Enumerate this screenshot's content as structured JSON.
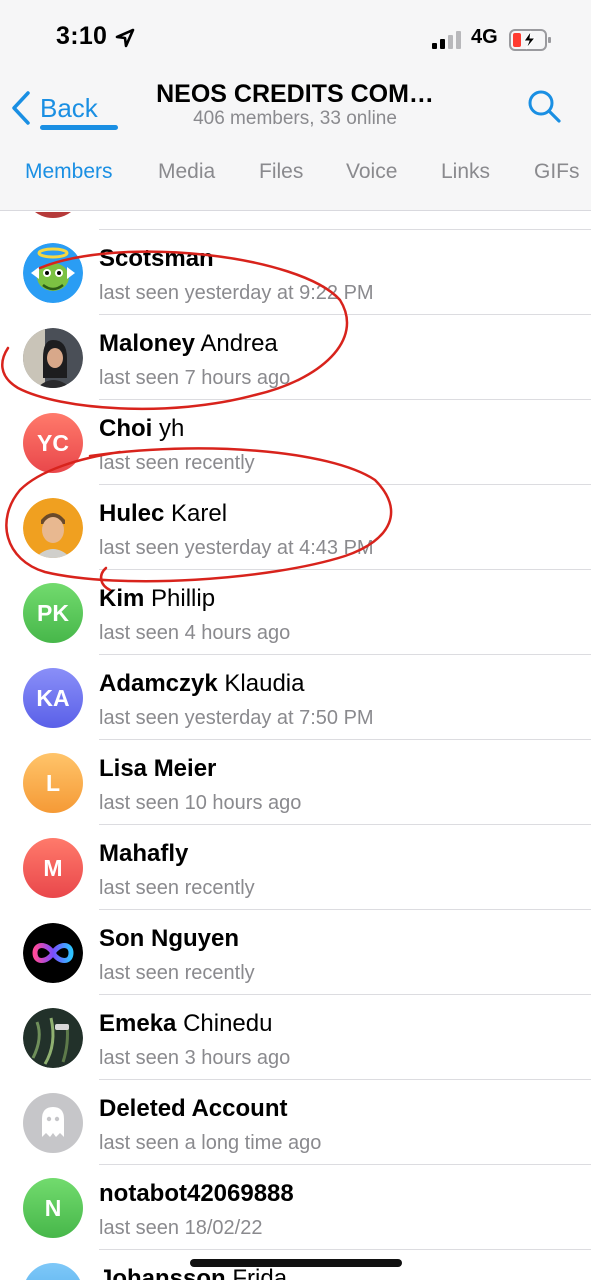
{
  "status_bar": {
    "time": "3:10",
    "network": "4G",
    "icons": [
      "location-arrow-icon",
      "signal-bars-icon",
      "battery-charging-icon"
    ]
  },
  "header": {
    "back_label": "Back",
    "title": "NEOS CREDITS COM…",
    "subtitle": "406 members, 33 online",
    "accent": "#1a8fe3"
  },
  "tabs": [
    {
      "label": "Members",
      "active": true
    },
    {
      "label": "Media"
    },
    {
      "label": "Files"
    },
    {
      "label": "Voice"
    },
    {
      "label": "Links"
    },
    {
      "label": "GIFs"
    }
  ],
  "members": [
    {
      "last": "Scotsman",
      "first": "",
      "status": "last seen yesterday at 9:22 PM",
      "avatar": "photo-cartoon-dragon",
      "color": "#2a9df4"
    },
    {
      "last": "Maloney",
      "first": "Andrea",
      "status": "last seen 7 hours ago",
      "avatar": "photo-person",
      "color": "#3a3f47"
    },
    {
      "last": "Choi",
      "first": "yh",
      "status": "last seen recently",
      "avatar": "initials",
      "initials": "YC",
      "color": "#f35d5d"
    },
    {
      "last": "Hulec",
      "first": "Karel",
      "status": "last seen yesterday at 4:43 PM",
      "avatar": "photo-person",
      "color": "#f0a020"
    },
    {
      "last": "Kim",
      "first": "Phillip",
      "status": "last seen 4 hours ago",
      "avatar": "initials",
      "initials": "PK",
      "color": "#56c85a"
    },
    {
      "last": "Adamczyk",
      "first": "Klaudia",
      "status": "last seen yesterday at 7:50 PM",
      "avatar": "initials",
      "initials": "KA",
      "color": "#6c74f0"
    },
    {
      "last": "Lisa Meier",
      "first": "",
      "status": "last seen 10 hours ago",
      "avatar": "initials",
      "initials": "L",
      "color": "#f8b14a"
    },
    {
      "last": "Mahafly",
      "first": "",
      "status": "last seen recently",
      "avatar": "initials",
      "initials": "M",
      "color": "#f35d5d"
    },
    {
      "last": "Son Nguyen",
      "first": "",
      "status": "last seen recently",
      "avatar": "photo-infinity-logo",
      "color": "#000000"
    },
    {
      "last": "Emeka",
      "first": "Chinedu",
      "status": "last seen 3 hours ago",
      "avatar": "photo-forest",
      "color": "#2e4030"
    },
    {
      "last": "Deleted Account",
      "first": "",
      "status": "last seen a long time ago",
      "avatar": "ghost-icon",
      "color": "#c6c6c9"
    },
    {
      "last": "notabot42069888",
      "first": "",
      "status": "last seen 18/02/22",
      "avatar": "initials",
      "initials": "N",
      "color": "#56c85a"
    },
    {
      "last": "Johansson",
      "first": "Frida",
      "status": "",
      "avatar": "initials",
      "initials": "",
      "color": "#5ab7f0"
    }
  ]
}
